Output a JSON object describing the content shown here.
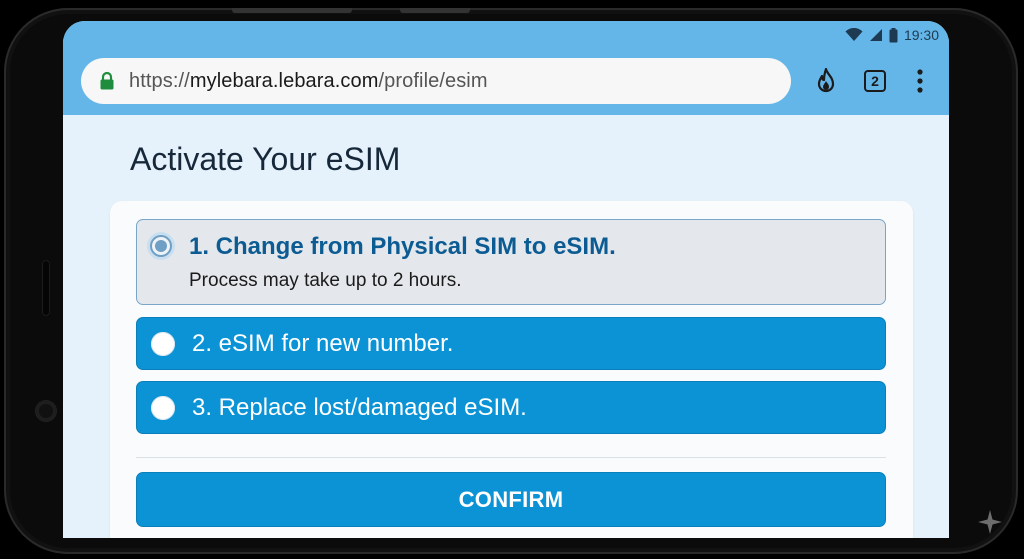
{
  "status_bar": {
    "time": "19:30",
    "icons": [
      "wifi-icon",
      "signal-icon",
      "battery-icon"
    ]
  },
  "browser": {
    "url_scheme": "https://",
    "url_host": "mylebara.lebara.com",
    "url_path": "/profile/esim",
    "lock_icon": "lock-icon",
    "toolbar_icons": [
      "flame-icon",
      "tabs-icon",
      "more-vert-icon"
    ],
    "tab_count": "2"
  },
  "page": {
    "title": "Activate Your eSIM",
    "options": [
      {
        "label": "1. Change from Physical SIM to eSIM.",
        "sublabel": "Process may take up to 2 hours.",
        "selected": true
      },
      {
        "label": "2. eSIM for new number.",
        "selected": false
      },
      {
        "label": "3. Replace lost/damaged eSIM.",
        "selected": false
      }
    ],
    "confirm_label": "CONFIRM"
  },
  "colors": {
    "browser_bar": "#64b6e8",
    "page_background": "#e5f2fb",
    "option_blue": "#0b93d6",
    "selected_title": "#0c5c93",
    "selected_background": "#e4e8ec"
  }
}
